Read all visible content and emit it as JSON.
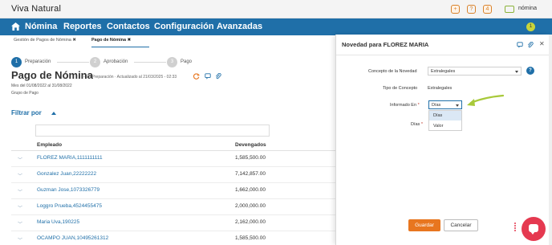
{
  "app": {
    "brand": "Viva Natural",
    "user_label": "nómina"
  },
  "topbar_icons": [
    {
      "name": "add-icon",
      "glyph": "+"
    },
    {
      "name": "help-icon",
      "glyph": "?"
    },
    {
      "name": "notification-icon",
      "glyph": "4"
    }
  ],
  "nav": {
    "items": [
      {
        "label": "Nómina"
      },
      {
        "label": "Reportes"
      },
      {
        "label": "Contactos"
      },
      {
        "label": "Configuración"
      },
      {
        "label": "Avanzadas"
      }
    ],
    "badge": "1"
  },
  "breadcrumbs": [
    {
      "label": "Gestión de Pagos de Nómina",
      "close": "✖"
    },
    {
      "label": "Pago de Nómina",
      "close": "✖"
    }
  ],
  "steps": [
    {
      "number": "1",
      "label": "Preparación",
      "state": "active"
    },
    {
      "number": "2",
      "label": "Aprobación",
      "state": "inactive"
    },
    {
      "number": "3",
      "label": "Pago",
      "state": "inactive"
    }
  ],
  "page": {
    "title": "Pago de Nómina",
    "status": "- En Preparación · Actualizado al 21/03/2025 - 02:33",
    "period": "Mes del 01/08/2022 al 31/08/2022",
    "group": "Grupo de Pago"
  },
  "filter": {
    "label": "Filtrar por"
  },
  "table": {
    "headers": {
      "employee": "Empleado",
      "earnings": "Devengados"
    },
    "rows": [
      {
        "employee": "FLOREZ MARIA,1111111111",
        "earnings": "1,585,500.00"
      },
      {
        "employee": "Gonzalez Juan,22222222",
        "earnings": "7,142,857.00"
      },
      {
        "employee": "Guzman Jose,1073326779",
        "earnings": "1,662,000.00"
      },
      {
        "employee": "Loggro Prueba,4524455475",
        "earnings": "2,000,000.00"
      },
      {
        "employee": "Maria Uva,190225",
        "earnings": "2,162,000.00"
      },
      {
        "employee": "OCAMPO JUAN,10495261312",
        "earnings": "1,585,500.00"
      }
    ]
  },
  "modal": {
    "title": "Novedad para FLOREZ MARIA",
    "fields": {
      "concept_label": "Concepto de la Novedad",
      "concept_value": "Extralegales",
      "type_label": "Tipo de Concepto",
      "type_value": "Extralegales",
      "reported_label": "Informado En",
      "reported_value": "Días",
      "days_label": "Días",
      "required_mark": "*"
    },
    "dropdown_options": [
      {
        "label": "Días",
        "highlighted": true
      },
      {
        "label": "Valor",
        "highlighted": false
      }
    ],
    "buttons": {
      "save": "Guardar",
      "cancel": "Cancelar"
    },
    "close": "✕",
    "help": "?"
  },
  "colors": {
    "nav_bg": "#1f6fa8",
    "accent_orange": "#e8761f",
    "arrow_green": "#a8c93a",
    "chat_red": "#e53950"
  }
}
